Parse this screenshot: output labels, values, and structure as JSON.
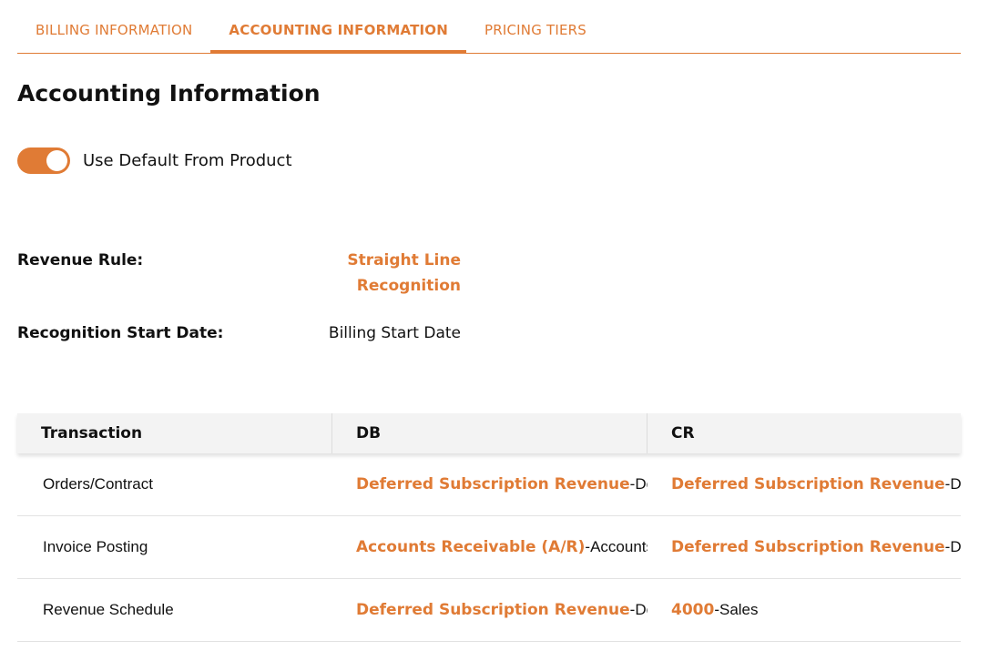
{
  "tabs": [
    {
      "label": "BILLING INFORMATION",
      "active": false
    },
    {
      "label": "ACCOUNTING INFORMATION",
      "active": true
    },
    {
      "label": "PRICING TIERS",
      "active": false
    }
  ],
  "page_title": "Accounting Information",
  "toggle": {
    "label": "Use Default From Product",
    "on": true
  },
  "fields": {
    "revenue_rule": {
      "label": "Revenue Rule:",
      "value_line1": "Straight Line",
      "value_line2": "Recognition"
    },
    "recognition_start": {
      "label": "Recognition Start Date:",
      "value": "Billing Start Date"
    }
  },
  "grid": {
    "headers": [
      "Transaction",
      "DB",
      "CR"
    ],
    "rows": [
      {
        "transaction": "Orders/Contract",
        "db": {
          "account": "Deferred Subscription Revenue",
          "desc": "-De"
        },
        "cr": {
          "account": "Deferred Subscription Revenue",
          "desc": "-De"
        }
      },
      {
        "transaction": "Invoice Posting",
        "db": {
          "account": "Accounts Receivable (A/R)",
          "desc": "-Accounts"
        },
        "cr": {
          "account": "Deferred Subscription Revenue",
          "desc": "-De"
        }
      },
      {
        "transaction": "Revenue Schedule",
        "db": {
          "account": "Deferred Subscription Revenue",
          "desc": "-De"
        },
        "cr": {
          "account": "4000",
          "desc": "-Sales"
        }
      }
    ]
  },
  "colors": {
    "accent": "#e07b35",
    "text": "#111111",
    "header_bg": "#f3f3f3",
    "divider": "#e2e2e2"
  }
}
